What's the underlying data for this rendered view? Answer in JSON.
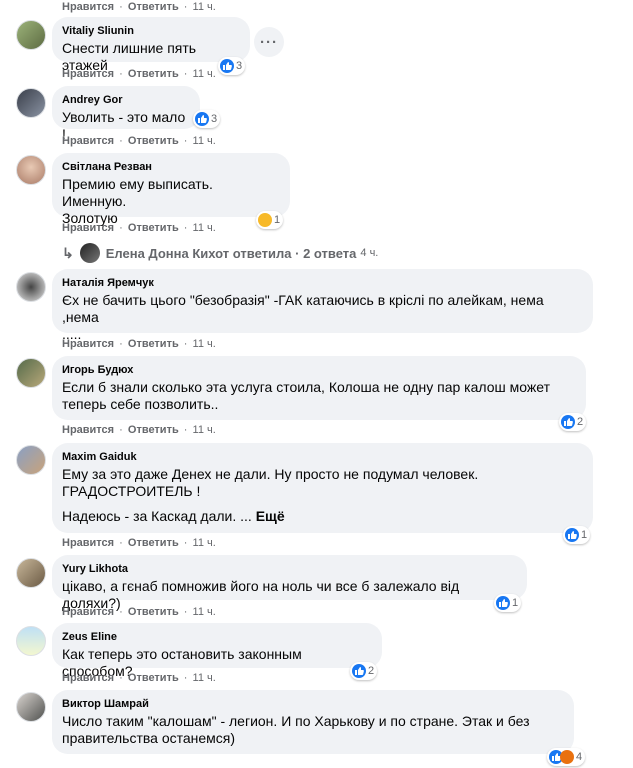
{
  "action_labels": {
    "like": "Нравится",
    "reply": "Ответить",
    "sep": "·"
  },
  "top_actions": {
    "time": "11 ч."
  },
  "comments": [
    {
      "author": "Vitaliy Sliunin",
      "text": "Снести лишние пять этажей",
      "time": "11 ч.",
      "reaction_count": "3"
    },
    {
      "author": "Andrey Gor",
      "text": "Уволить - это мало !",
      "time": "11 ч.",
      "reaction_count": "3"
    },
    {
      "author": "Світлана Резван",
      "text": "Премию ему выписать. Именную.\nЗолотую",
      "time": "11 ч.",
      "reaction_count": "1"
    },
    {
      "author": "Наталія Яремчук",
      "text": "Єх не бачить цього \"безобразія\" -ГАК катаючись в кріслі по алейкам, нема ,нема\n.....",
      "time": "11 ч."
    },
    {
      "author": "Игорь Будюх",
      "text": "Если б знали сколько эта услуга стоила, Колоша не одну пар калош может\nтеперь себе позволить..",
      "time": "11 ч.",
      "reaction_count": "2"
    },
    {
      "author": "Maxim Gaiduk",
      "text": "Ему за это даже Денех не дали. Ну просто не подумал человек.\nГРАДОСТРОИТЕЛЬ !",
      "text2": "Надеюсь - за Каскад дали. ...",
      "more": "Ещё",
      "time": "11 ч.",
      "reaction_count": "1"
    },
    {
      "author": "Yury Likhota",
      "text": "цікаво, а гєнаб помножив його на ноль чи все б залежало від доляхи?)",
      "time": "11 ч.",
      "reaction_count": "1"
    },
    {
      "author": "Zeus Eline",
      "text": "Как теперь это остановить законным способом?",
      "time": "11 ч.",
      "reaction_count": "2"
    },
    {
      "author": "Виктор Шамрай",
      "text": "Число таким \"калошам\" - легион. И по Харькову и по стране. Этак и без\nправительства останемся)",
      "reaction_count": "4"
    }
  ],
  "reply_summary": {
    "author": "Елена Донна Кихот",
    "verb": "ответила",
    "sep": "·",
    "count": "2 ответа",
    "time": "4 ч."
  },
  "more_button": "···",
  "colors": {
    "bubble": "#f0f2f5",
    "meta": "#65676b",
    "like": "#1877f2"
  }
}
